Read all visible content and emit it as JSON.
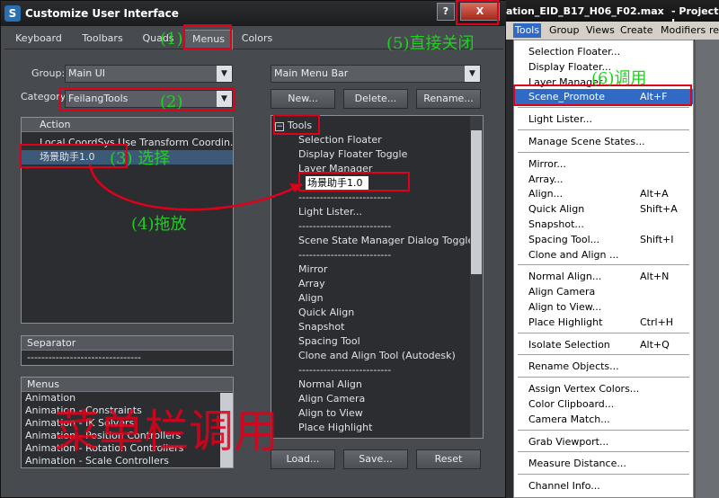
{
  "dialog": {
    "title": "Customize User Interface",
    "help_label": "?",
    "close_label": "X",
    "tabs": [
      "Keyboard",
      "Toolbars",
      "Quads",
      "Menus",
      "Colors"
    ],
    "group_label": "Group:",
    "group_value": "Main UI",
    "category_label": "Category:",
    "category_value": "FeilangTools",
    "action_header": "Action",
    "actions": [
      "Local CoordSys Use Transform Coordin...",
      "场景助手1.0"
    ],
    "separator_header": "Separator",
    "separator_item": "--------------------------------",
    "menus_header": "Menus",
    "menus": [
      "Animation",
      "Animation - Constraints",
      "Animation - IK Solvers",
      "Animation - Position Controllers",
      "Animation - Rotation Controllers",
      "Animation - Scale Controllers"
    ],
    "menubar_value": "Main Menu Bar",
    "new_label": "New...",
    "delete_label": "Delete...",
    "rename_label": "Rename...",
    "tree_root": "Tools",
    "tree_items": [
      "Selection Floater",
      "Display Floater Toggle",
      "Layer Manager",
      "场景助手1.0",
      "--------------------------",
      "Light Lister...",
      "--------------------------",
      "Scene State Manager Dialog Toggle",
      "--------------------------",
      "Mirror",
      "Array",
      "Align",
      "Quick Align",
      "Snapshot",
      "Spacing Tool",
      "Clone and Align Tool (Autodesk)",
      "--------------------------",
      "Normal Align",
      "Align Camera",
      "Align to View",
      "Place Highlight"
    ],
    "load_label": "Load...",
    "save_label": "Save...",
    "reset_label": "Reset"
  },
  "annotations": {
    "a1": "(1)",
    "a2": "(2)",
    "a3": "(3) 选择",
    "a4": "(4)拖放",
    "a5": "(5)直接关闭",
    "a6": "(6)调用",
    "big": "菜单栏调用"
  },
  "max": {
    "title": "ation_EID_B17_H06_F02.max",
    "project": "- Project I",
    "menubar": [
      "Tools",
      "Group",
      "Views",
      "Create",
      "Modifiers",
      "re"
    ],
    "menu": [
      {
        "label": "Selection Floater...",
        "shortcut": ""
      },
      {
        "label": "Display Floater...",
        "shortcut": ""
      },
      {
        "label": "Layer Manager...",
        "shortcut": ""
      },
      {
        "label": "Scene_Promote",
        "shortcut": "Alt+F"
      },
      {
        "label": "Light Lister...",
        "shortcut": ""
      },
      {
        "label": "Manage Scene States...",
        "shortcut": ""
      },
      {
        "label": "Mirror...",
        "shortcut": ""
      },
      {
        "label": "Array...",
        "shortcut": ""
      },
      {
        "label": "Align...",
        "shortcut": "Alt+A"
      },
      {
        "label": "Quick Align",
        "shortcut": "Shift+A"
      },
      {
        "label": "Snapshot...",
        "shortcut": ""
      },
      {
        "label": "Spacing Tool...",
        "shortcut": "Shift+I"
      },
      {
        "label": "Clone and Align ...",
        "shortcut": ""
      },
      {
        "label": "Normal Align...",
        "shortcut": "Alt+N"
      },
      {
        "label": "Align Camera",
        "shortcut": ""
      },
      {
        "label": "Align to View...",
        "shortcut": ""
      },
      {
        "label": "Place Highlight",
        "shortcut": "Ctrl+H"
      },
      {
        "label": "Isolate Selection",
        "shortcut": "Alt+Q"
      },
      {
        "label": "Rename Objects...",
        "shortcut": ""
      },
      {
        "label": "Assign Vertex Colors...",
        "shortcut": ""
      },
      {
        "label": "Color Clipboard...",
        "shortcut": ""
      },
      {
        "label": "Camera Match...",
        "shortcut": ""
      },
      {
        "label": "Grab Viewport...",
        "shortcut": ""
      },
      {
        "label": "Measure Distance...",
        "shortcut": ""
      },
      {
        "label": "Channel Info...",
        "shortcut": ""
      }
    ]
  },
  "colors": {
    "annotation": "#1fd11f",
    "highlight": "#e0001a",
    "selected": "#316ac5"
  }
}
